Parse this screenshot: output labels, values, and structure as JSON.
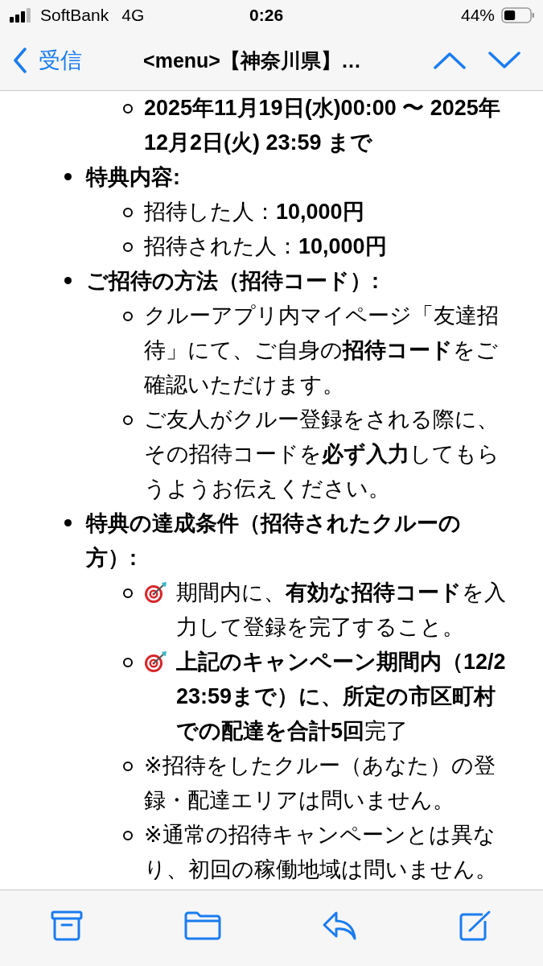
{
  "status_bar": {
    "carrier": "SoftBank",
    "network": "4G",
    "time": "0:26",
    "battery": "44%"
  },
  "nav": {
    "back": "受信",
    "title": "<menu>【神奈川県】…"
  },
  "lead_children": [
    {
      "text": "2025年11月19日(水)00:00 〜 2025年12月2日(火) 23:59 まで",
      "bold": true,
      "target_icon": false
    }
  ],
  "items": [
    {
      "text": "特典内容:",
      "bold": true,
      "children": [
        {
          "text": "招待した人：**10,000円**",
          "bold": false,
          "target_icon": false
        },
        {
          "text": "招待された人：**10,000円**",
          "bold": false,
          "target_icon": false
        }
      ]
    },
    {
      "text": "ご招待の方法（招待コード）:",
      "bold": true,
      "children": [
        {
          "text": "クルーアプリ内マイページ「友達招待」にて、ご自身の**招待コード**をご確認いただけます。",
          "bold": false,
          "target_icon": false
        },
        {
          "text": "ご友人がクルー登録をされる際に、その招待コードを**必ず入力**してもらうようお伝えください。",
          "bold": false,
          "target_icon": false
        }
      ]
    },
    {
      "text": "特典の達成条件（招待されたクルーの方）:",
      "bold": true,
      "children": [
        {
          "text": "期間内に、**有効な招待コード**を入力して登録を完了すること。",
          "bold": false,
          "target_icon": true
        },
        {
          "text": "**上記のキャンペーン期間内（12/2 23:59まで）に、所定の市区町村での配達を合計5回**完了",
          "bold": false,
          "target_icon": true
        },
        {
          "text": "※招待をしたクルー（あなた）の登録・配達エリアは問いません。",
          "bold": false,
          "target_icon": false
        },
        {
          "text": "※通常の招待キャンペーンとは異なり、初回の稼働地域は問いません。",
          "bold": false,
          "target_icon": false
        }
      ]
    }
  ]
}
